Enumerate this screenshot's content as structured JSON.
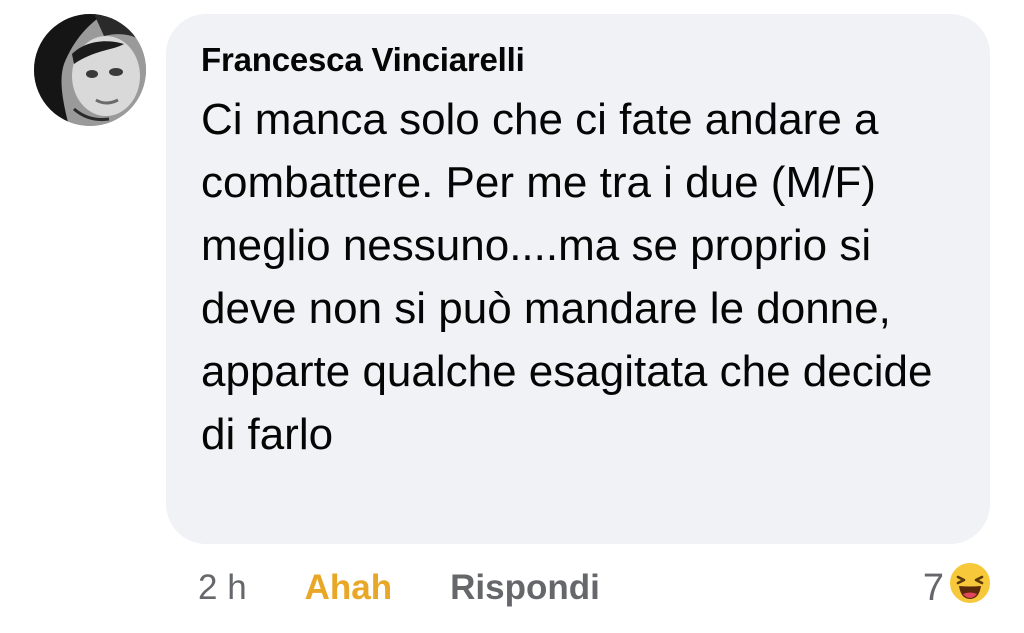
{
  "comment": {
    "author": "Francesca Vinciarelli",
    "text": "Ci manca solo che ci fate andare a combattere. Per me tra i due (M/F) meglio nessuno....ma se proprio si deve non si può mandare le donne, apparte qualche esagitata che decide di farlo",
    "time": "2 h",
    "reaction_label": "Ahah",
    "reply_label": "Rispondi",
    "reaction_count": "7",
    "reaction_icon": "laughing-face-icon"
  },
  "colors": {
    "bubble": "#f0f2f5",
    "reaction_active": "#e8a726",
    "secondary_text": "#65676b",
    "primary_text": "#050505"
  }
}
